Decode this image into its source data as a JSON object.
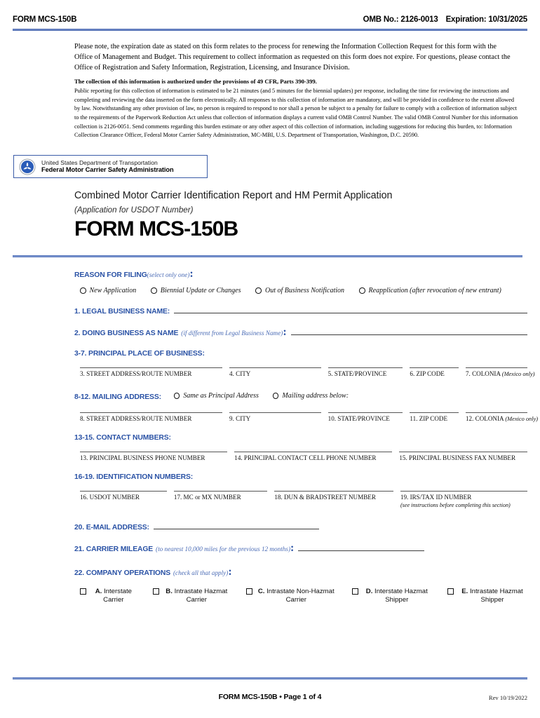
{
  "header": {
    "form_id": "FORM MCS-150B",
    "omb_number": "OMB No.: 2126-0013",
    "expiration": "Expiration: 10/31/2025"
  },
  "notice": {
    "paragraph": "Please note, the expiration date as stated on this form relates to the process for renewing the Information Collection Request for this form with the Office of Management and Budget. This requirement to collect information as requested on this form does not expire. For questions, please contact the Office of Registration and Safety Information, Registration, Licensing, and Insurance Division."
  },
  "burden": {
    "heading": "The collection of this information is authorized under the provisions of 49 CFR, Parts 390-399.",
    "body": "Public reporting for this collection of information is estimated to be 21 minutes (and 5 minutes for the biennial updates) per response, including the time for reviewing the instructions and completing and reviewing the data inserted on the form electronically. All responses to this collection of information are mandatory, and will be provided in confidence to the extent allowed by law. Notwithstanding any other provision of law, no person is required to respond to nor shall a person be subject to a penalty for failure to comply with a collection of information subject to the requirements of the Paperwork Reduction Act unless that collection of information displays a current valid OMB Control Number. The valid OMB Control Number for this information collection is 2126-0051. Send comments regarding this burden estimate or any other aspect of this collection of information, including suggestions for reducing this burden, to: Information Collection Clearance Officer, Federal Motor Carrier Safety Administration, MC-MBI, U.S. Department of Transportation, Washington, D.C. 20590."
  },
  "agency": {
    "line1": "United States Department of Transportation",
    "line2": "Federal Motor Carrier Safety Administration",
    "seal_color": "#2a5cb8"
  },
  "title": {
    "main": "Combined Motor Carrier Identification Report and HM Permit Application",
    "sub": "(Application for USDOT Number)",
    "form": "FORM MCS-150B"
  },
  "colors": {
    "accent_blue": "#2a52a5",
    "rule_blue": "#7a95d1"
  },
  "reason": {
    "label": "REASON FOR FILING",
    "note": "(select only one)",
    "options": [
      "New Application",
      "Biennial Update or Changes",
      "Out of Business Notification",
      "Reapplication (after revocation of new entrant)"
    ]
  },
  "field1": {
    "label": "1. LEGAL BUSINESS NAME:"
  },
  "field2": {
    "label": "2. DOING BUSINESS AS NAME",
    "note": "(if different from Legal Business Name)"
  },
  "principal": {
    "heading": "3-7. PRINCIPAL PLACE OF BUSINESS:",
    "columns": [
      {
        "caption": "3. STREET ADDRESS/ROUTE NUMBER",
        "note": ""
      },
      {
        "caption": "4. CITY",
        "note": ""
      },
      {
        "caption": "5. STATE/PROVINCE",
        "note": ""
      },
      {
        "caption": "6. ZIP CODE",
        "note": ""
      },
      {
        "caption": "7. COLONIA",
        "note": "(Mexico only)"
      }
    ]
  },
  "mailing": {
    "heading": "8-12. MAILING ADDRESS:",
    "options": [
      "Same as Principal Address",
      "Mailing address below:"
    ],
    "columns": [
      {
        "caption": "8. STREET ADDRESS/ROUTE NUMBER",
        "note": ""
      },
      {
        "caption": "9. CITY",
        "note": ""
      },
      {
        "caption": "10. STATE/PROVINCE",
        "note": ""
      },
      {
        "caption": "11. ZIP CODE",
        "note": ""
      },
      {
        "caption": "12. COLONIA",
        "note": "(Mexico only)"
      }
    ]
  },
  "contact": {
    "heading": "13-15. CONTACT NUMBERS:",
    "columns": [
      {
        "caption": "13. PRINCIPAL BUSINESS PHONE NUMBER"
      },
      {
        "caption": "14. PRINCIPAL CONTACT CELL PHONE NUMBER"
      },
      {
        "caption": "15. PRINCIPAL BUSINESS FAX NUMBER"
      }
    ]
  },
  "identification": {
    "heading": "16-19. IDENTIFICATION NUMBERS:",
    "columns": [
      {
        "caption": "16. USDOT NUMBER",
        "sub": ""
      },
      {
        "caption": "17. MC or MX NUMBER",
        "sub": ""
      },
      {
        "caption": "18. DUN & BRADSTREET NUMBER",
        "sub": ""
      },
      {
        "caption": "19. IRS/TAX ID NUMBER",
        "sub": "(see instructions before completing this section)"
      }
    ]
  },
  "field20": {
    "label": "20. E-MAIL ADDRESS:"
  },
  "field21": {
    "label": "21. CARRIER MILEAGE",
    "note": "(to nearest 10,000 miles for the previous 12 months)"
  },
  "operations": {
    "label": "22. COMPANY OPERATIONS",
    "note": "(check all that apply)",
    "options": [
      {
        "letter": "A.",
        "text": "Interstate Carrier"
      },
      {
        "letter": "B.",
        "text": "Intrastate Hazmat Carrier"
      },
      {
        "letter": "C.",
        "text": "Intrastate Non-Hazmat Carrier"
      },
      {
        "letter": "D.",
        "text": "Interstate Hazmat Shipper"
      },
      {
        "letter": "E.",
        "text": "Intrastate Hazmat Shipper"
      }
    ]
  },
  "footer": {
    "center": "FORM MCS-150B • Page 1 of 4",
    "revision": "Rev 10/19/2022"
  }
}
